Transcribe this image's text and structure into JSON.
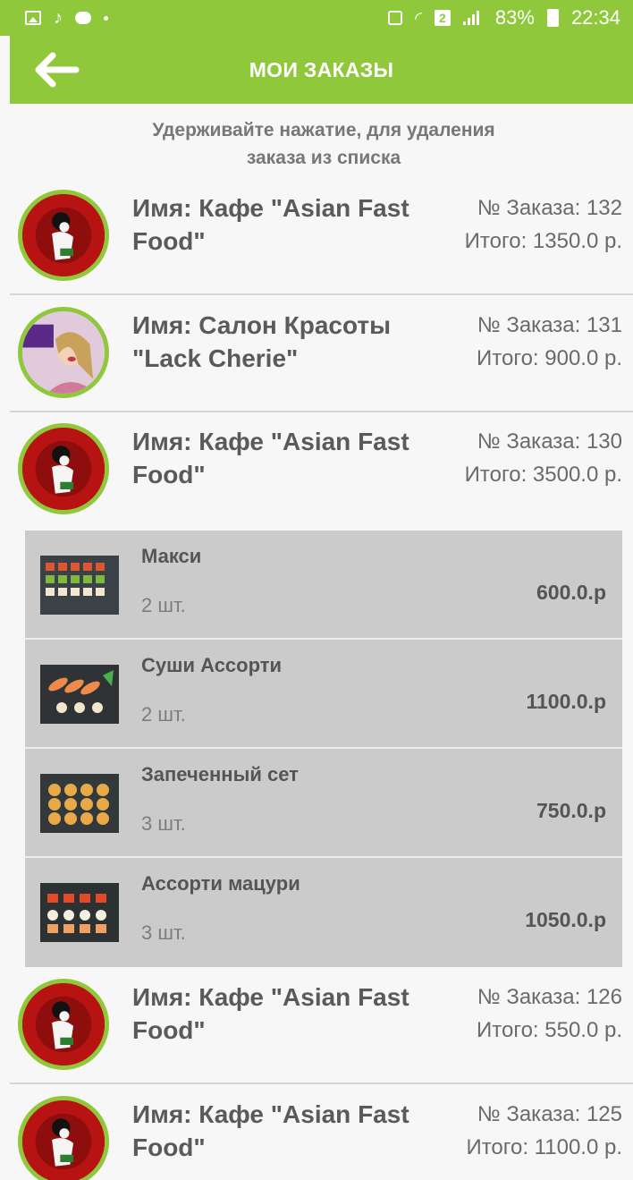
{
  "status_bar": {
    "battery": "83%",
    "time": "22:34",
    "sim_label": "2"
  },
  "header": {
    "title": "МОИ ЗАКАЗЫ"
  },
  "hint": {
    "line1": "Удерживайте нажатие, для удаления",
    "line2": "заказа из списка"
  },
  "orders": [
    {
      "name_line1": "Имя: Кафе \"Asian Fast",
      "name_line2": "Food\"",
      "number": "№ Заказа: 132",
      "total": "Итого: 1350.0 р.",
      "avatar_icon": "geisha-logo"
    },
    {
      "name_line1": "Имя: Салон Красоты",
      "name_line2": "\"Lack Cherie\"",
      "number": "№ Заказа: 131",
      "total": "Итого: 900.0 р.",
      "avatar_icon": "beauty-salon-photo"
    },
    {
      "name_line1": "Имя: Кафе \"Asian Fast",
      "name_line2": "Food\"",
      "number": "№ Заказа: 130",
      "total": "Итого: 3500.0 р.",
      "avatar_icon": "geisha-logo"
    },
    {
      "name_line1": "Имя: Кафе \"Asian Fast",
      "name_line2": "Food\"",
      "number": "№ Заказа: 126",
      "total": "Итого: 550.0 р.",
      "avatar_icon": "geisha-logo"
    },
    {
      "name_line1": "Имя: Кафе \"Asian Fast",
      "name_line2": "Food\"",
      "number": "№ Заказа: 125",
      "total": "Итого: 1100.0 р.",
      "avatar_icon": "geisha-logo"
    }
  ],
  "expanded_order_items": [
    {
      "name": "Макси",
      "qty": "2 шт.",
      "price": "600.0.р",
      "image_icon": "sushi-set-image"
    },
    {
      "name": "Суши Ассорти",
      "qty": "2 шт.",
      "price": "1100.0.р",
      "image_icon": "sushi-assorted-image"
    },
    {
      "name": "Запеченный сет",
      "qty": "3 шт.",
      "price": "750.0.р",
      "image_icon": "baked-set-image"
    },
    {
      "name": "Ассорти мацури",
      "qty": "3 шт.",
      "price": "1050.0.р",
      "image_icon": "matsuri-set-image"
    }
  ],
  "colors": {
    "accent": "#8fc83b",
    "item_background": "#cbcbcb",
    "avatar_red": "#b71313"
  }
}
